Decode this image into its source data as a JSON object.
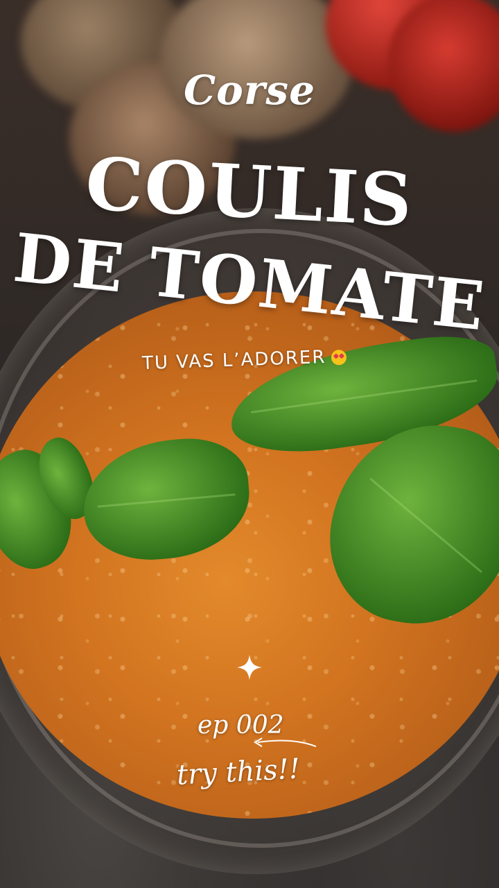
{
  "header": {
    "script_title": "Corse",
    "title_line1": "COULIS",
    "title_line2": "DE TOMATE",
    "subtitle": "TU VAS L’ADORER"
  },
  "footer": {
    "episode": "ep 002",
    "call_to_action": "try this!!"
  },
  "icons": {
    "sparkle": "four-point-star-icon",
    "emoji": "heart-eyes-emoji-icon",
    "arrow": "hand-drawn-arrow-icon"
  },
  "colors": {
    "text": "#ffffff",
    "sauce": "#d27420",
    "basil": "#2f7019"
  }
}
